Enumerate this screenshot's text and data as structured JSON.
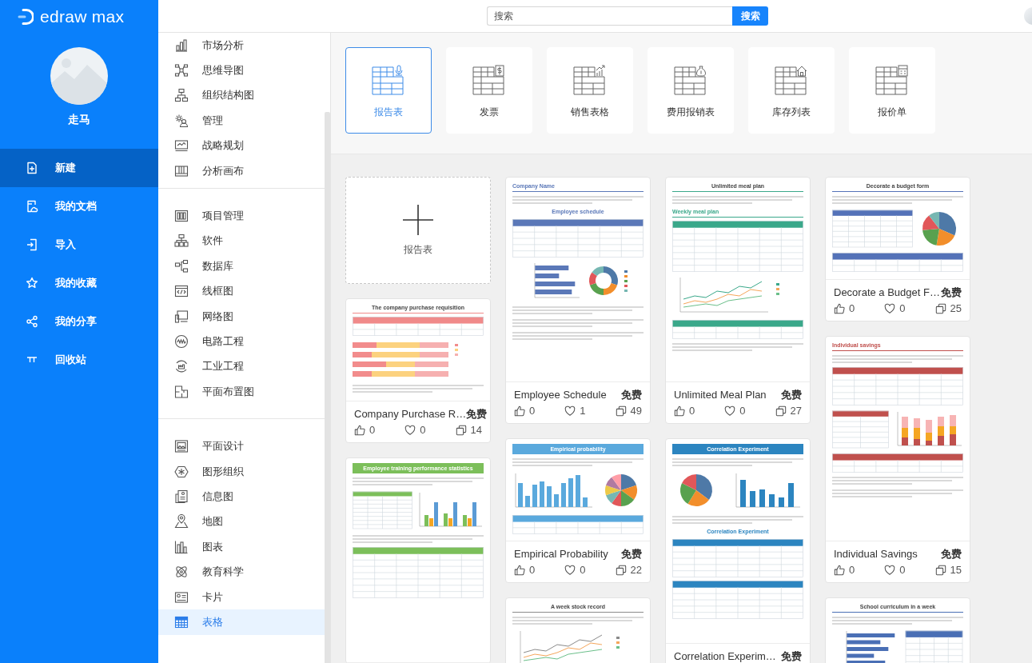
{
  "sidebar": {
    "logo": "edraw max",
    "user": {
      "name": "走马"
    },
    "nav": [
      {
        "label": "新建",
        "selected": true
      },
      {
        "label": "我的文档",
        "selected": false
      },
      {
        "label": "导入",
        "selected": false
      },
      {
        "label": "我的收藏",
        "selected": false
      },
      {
        "label": "我的分享",
        "selected": false
      },
      {
        "label": "回收站",
        "selected": false
      }
    ]
  },
  "header": {
    "search": {
      "placeholder": "搜索"
    },
    "search_button": "搜索"
  },
  "categories": {
    "groups": [
      {
        "items": [
          {
            "label": "市场分析",
            "selected": false
          },
          {
            "label": "思维导图",
            "selected": false
          },
          {
            "label": "组织结构图",
            "selected": false
          },
          {
            "label": "管理",
            "selected": false
          },
          {
            "label": "战略规划",
            "selected": false
          },
          {
            "label": "分析画布",
            "selected": false
          }
        ]
      },
      {
        "items": [
          {
            "label": "项目管理",
            "selected": false
          },
          {
            "label": "软件",
            "selected": false
          },
          {
            "label": "数据库",
            "selected": false
          },
          {
            "label": "线框图",
            "selected": false
          },
          {
            "label": "网络图",
            "selected": false
          },
          {
            "label": "电路工程",
            "selected": false
          },
          {
            "label": "工业工程",
            "selected": false
          },
          {
            "label": "平面布置图",
            "selected": false
          }
        ]
      },
      {
        "items": [
          {
            "label": "平面设计",
            "selected": false
          },
          {
            "label": "图形组织",
            "selected": false
          },
          {
            "label": "信息图",
            "selected": false
          },
          {
            "label": "地图",
            "selected": false
          },
          {
            "label": "图表",
            "selected": false
          },
          {
            "label": "教育科学",
            "selected": false
          },
          {
            "label": "卡片",
            "selected": false
          },
          {
            "label": "表格",
            "selected": true
          }
        ]
      }
    ]
  },
  "template_types": [
    {
      "label": "报告表",
      "selected": true
    },
    {
      "label": "发票",
      "selected": false
    },
    {
      "label": "销售表格",
      "selected": false
    },
    {
      "label": "费用报销表",
      "selected": false
    },
    {
      "label": "库存列表",
      "selected": false
    },
    {
      "label": "报价单",
      "selected": false
    }
  ],
  "templates": {
    "columns": [
      {
        "cards": [
          {
            "kind": "new",
            "label": "报告表"
          },
          {
            "kind": "template",
            "title": "Company Purchase R…",
            "price": "免费",
            "stats": {
              "thumbs_up": "0",
              "hearts": "0",
              "copies": "14"
            },
            "preview": {
              "landscape": true,
              "color": "#f08a8a",
              "blocks": [
                {
                  "kind": "title",
                  "text": "The company purchase requisition"
                },
                {
                  "kind": "table-small"
                },
                {
                  "kind": "stacked-hbars"
                },
                {
                  "kind": "text"
                }
              ]
            }
          },
          {
            "kind": "template",
            "preview": {
              "landscape": false,
              "color": "#7cbf5a",
              "blocks": [
                {
                  "kind": "banner",
                  "text": "Employee training performance statistics"
                },
                {
                  "kind": "text"
                },
                {
                  "kind": "table-bars"
                },
                {
                  "kind": "text"
                },
                {
                  "kind": "table-tall"
                }
              ]
            }
          }
        ]
      },
      {
        "cards": [
          {
            "kind": "template",
            "title": "Employee Schedule",
            "price": "免费",
            "stats": {
              "thumbs_up": "0",
              "hearts": "1",
              "copies": "49"
            },
            "preview": {
              "landscape": false,
              "color": "#5b78b8",
              "blocks": [
                {
                  "kind": "subheading",
                  "text": "Company Name"
                },
                {
                  "kind": "text"
                },
                {
                  "kind": "heading",
                  "text": "Employee schedule"
                },
                {
                  "kind": "table"
                },
                {
                  "kind": "hbars-donut"
                },
                {
                  "kind": "text"
                },
                {
                  "kind": "text"
                },
                {
                  "kind": "text"
                }
              ]
            }
          },
          {
            "kind": "template",
            "title": "Empirical Probability",
            "price": "免费",
            "stats": {
              "thumbs_up": "0",
              "hearts": "0",
              "copies": "22"
            },
            "preview": {
              "landscape": true,
              "color": "#5aa9dd",
              "blocks": [
                {
                  "kind": "banner",
                  "text": "Empirical probability"
                },
                {
                  "kind": "text"
                },
                {
                  "kind": "vbars-pie"
                },
                {
                  "kind": "table-small"
                }
              ]
            }
          },
          {
            "kind": "template",
            "preview": {
              "color": "#8a8a8a",
              "blocks": [
                {
                  "kind": "title",
                  "text": "A week stock record"
                },
                {
                  "kind": "text"
                },
                {
                  "kind": "lines"
                }
              ]
            }
          }
        ]
      },
      {
        "cards": [
          {
            "kind": "template",
            "title": "Unlimited Meal Plan",
            "price": "免费",
            "stats": {
              "thumbs_up": "0",
              "hearts": "0",
              "copies": "27"
            },
            "preview": {
              "landscape": false,
              "color": "#3aa88a",
              "blocks": [
                {
                  "kind": "title",
                  "text": "Unlimited meal plan"
                },
                {
                  "kind": "text"
                },
                {
                  "kind": "subheading",
                  "text": "Weekly meal plan"
                },
                {
                  "kind": "table-tall"
                },
                {
                  "kind": "lines"
                },
                {
                  "kind": "table-small"
                },
                {
                  "kind": "text"
                }
              ]
            }
          },
          {
            "kind": "template",
            "title": "Correlation Experim…",
            "price": "免费",
            "preview": {
              "landscape": false,
              "color": "#2c85c0",
              "blocks": [
                {
                  "kind": "banner",
                  "text": "Correlation Experiment"
                },
                {
                  "kind": "text"
                },
                {
                  "kind": "pie-vbars"
                },
                {
                  "kind": "text"
                },
                {
                  "kind": "heading",
                  "text": "Correlation Experiment"
                },
                {
                  "kind": "table"
                },
                {
                  "kind": "table"
                }
              ]
            }
          }
        ]
      },
      {
        "cards": [
          {
            "kind": "template",
            "title": "Decorate a Budget F…",
            "price": "免费",
            "stats": {
              "thumbs_up": "0",
              "hearts": "0",
              "copies": "25"
            },
            "preview": {
              "landscape": true,
              "color": "#5472b8",
              "blocks": [
                {
                  "kind": "title",
                  "text": "Decorate a budget form"
                },
                {
                  "kind": "text"
                },
                {
                  "kind": "table-pie"
                },
                {
                  "kind": "table-small"
                }
              ]
            }
          },
          {
            "kind": "template",
            "title": "Individual Savings",
            "price": "免费",
            "stats": {
              "thumbs_up": "0",
              "hearts": "0",
              "copies": "15"
            },
            "preview": {
              "landscape": false,
              "color": "#c0504d",
              "blocks": [
                {
                  "kind": "subheading",
                  "text": "Individual savings"
                },
                {
                  "kind": "text"
                },
                {
                  "kind": "table"
                },
                {
                  "kind": "table-stacked-vbars"
                },
                {
                  "kind": "table-small"
                },
                {
                  "kind": "text"
                },
                {
                  "kind": "text"
                }
              ]
            }
          },
          {
            "kind": "template",
            "preview": {
              "color": "#4a6fb5",
              "blocks": [
                {
                  "kind": "title",
                  "text": "School curriculum in a week"
                },
                {
                  "kind": "text"
                },
                {
                  "kind": "hbars-table"
                }
              ]
            }
          }
        ]
      }
    ]
  }
}
